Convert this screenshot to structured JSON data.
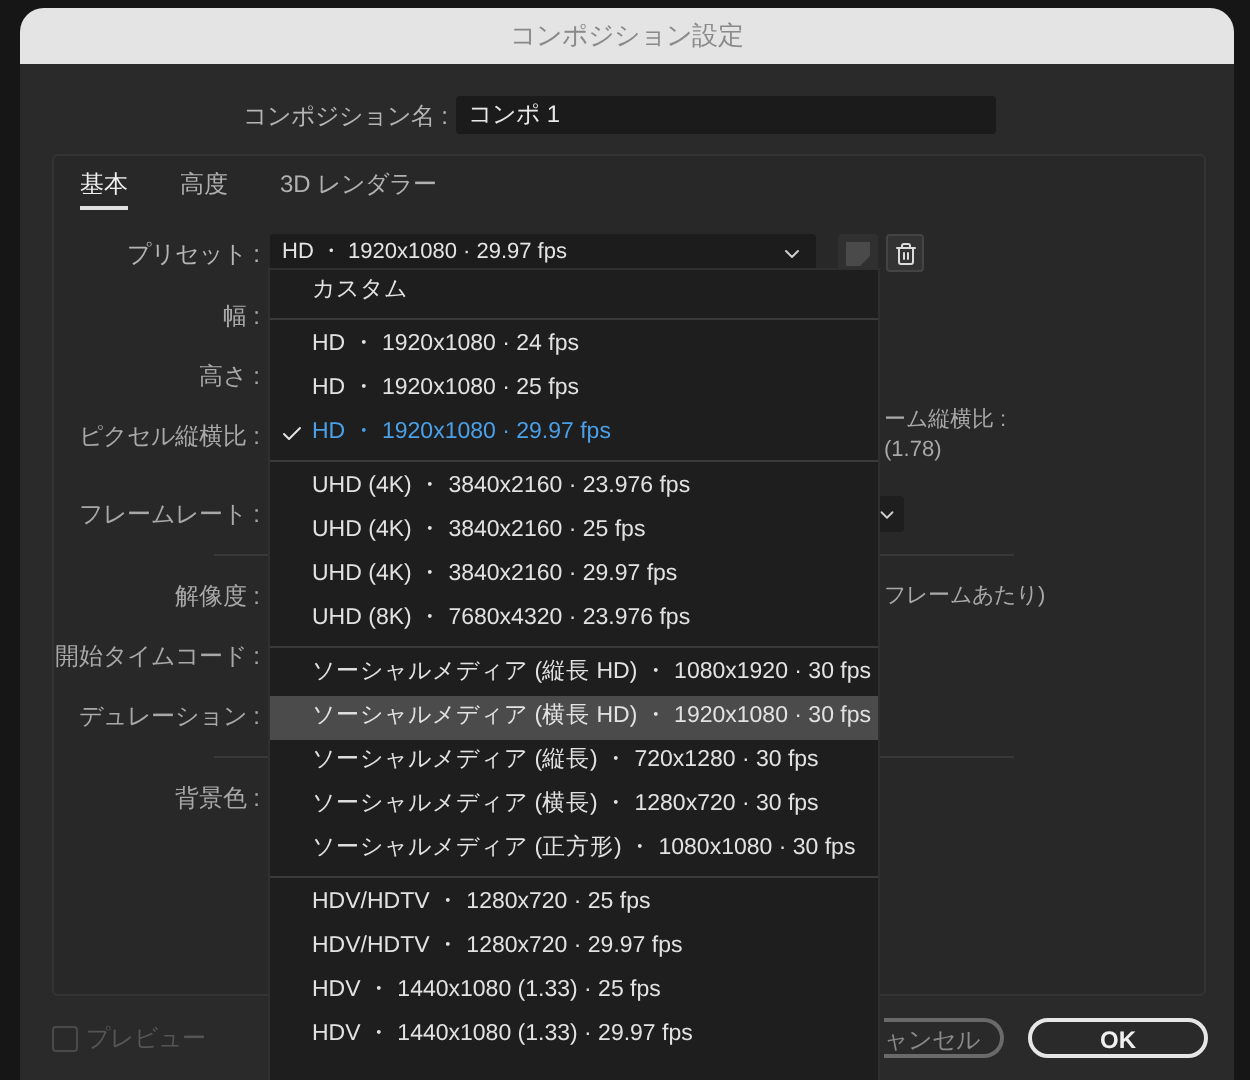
{
  "window": {
    "title": "コンポジション設定"
  },
  "composition_name": {
    "label": "コンポジション名 :",
    "value": "コンポ 1"
  },
  "tabs": [
    {
      "label": "基本",
      "selected": true
    },
    {
      "label": "高度",
      "selected": false
    },
    {
      "label": "3D レンダラー",
      "selected": false
    }
  ],
  "preset": {
    "label": "プリセット :",
    "value": "HD ・ 1920x1080 · 29.97 fps"
  },
  "fields": [
    {
      "label": "幅 :"
    },
    {
      "label": "高さ :"
    },
    {
      "label": "ピクセル縦横比 :",
      "aside": [
        "ーム縦横比 :",
        "(1.78)"
      ]
    },
    {
      "label": "フレームレート :",
      "dropdown": true
    },
    {
      "label": "解像度 :",
      "aside": [
        "フレームあたり)"
      ],
      "divider_before": true
    },
    {
      "label": "開始タイムコード :"
    },
    {
      "label": "デュレーション :"
    },
    {
      "label": "背景色 :",
      "divider_before": true
    }
  ],
  "preset_menu": [
    {
      "kind": "item",
      "label": "カスタム",
      "selected": false,
      "highlighted": false
    },
    {
      "kind": "separator"
    },
    {
      "kind": "item",
      "label": "HD ・ 1920x1080 · 24 fps",
      "selected": false,
      "highlighted": false
    },
    {
      "kind": "item",
      "label": "HD ・ 1920x1080 · 25 fps",
      "selected": false,
      "highlighted": false
    },
    {
      "kind": "item",
      "label": "HD ・ 1920x1080 · 29.97 fps",
      "selected": true,
      "highlighted": false
    },
    {
      "kind": "separator"
    },
    {
      "kind": "item",
      "label": "UHD (4K) ・ 3840x2160 · 23.976 fps",
      "selected": false,
      "highlighted": false
    },
    {
      "kind": "item",
      "label": "UHD (4K) ・ 3840x2160 · 25 fps",
      "selected": false,
      "highlighted": false
    },
    {
      "kind": "item",
      "label": "UHD (4K) ・ 3840x2160 · 29.97 fps",
      "selected": false,
      "highlighted": false
    },
    {
      "kind": "item",
      "label": "UHD (8K) ・ 7680x4320 · 23.976 fps",
      "selected": false,
      "highlighted": false
    },
    {
      "kind": "separator"
    },
    {
      "kind": "item",
      "label": "ソーシャルメディア (縦長 HD) ・ 1080x1920 · 30 fps",
      "selected": false,
      "highlighted": false
    },
    {
      "kind": "item",
      "label": "ソーシャルメディア (横長 HD) ・ 1920x1080 · 30 fps",
      "selected": false,
      "highlighted": true
    },
    {
      "kind": "item",
      "label": "ソーシャルメディア (縦長) ・ 720x1280 · 30 fps",
      "selected": false,
      "highlighted": false
    },
    {
      "kind": "item",
      "label": "ソーシャルメディア (横長) ・ 1280x720 · 30 fps",
      "selected": false,
      "highlighted": false
    },
    {
      "kind": "item",
      "label": "ソーシャルメディア (正方形) ・ 1080x1080 · 30 fps",
      "selected": false,
      "highlighted": false
    },
    {
      "kind": "separator"
    },
    {
      "kind": "item",
      "label": "HDV/HDTV ・ 1280x720 · 25 fps",
      "selected": false,
      "highlighted": false
    },
    {
      "kind": "item",
      "label": "HDV/HDTV ・ 1280x720 · 29.97 fps",
      "selected": false,
      "highlighted": false
    },
    {
      "kind": "item",
      "label": "HDV ・ 1440x1080 (1.33) · 25 fps",
      "selected": false,
      "highlighted": false
    },
    {
      "kind": "item",
      "label": "HDV ・ 1440x1080 (1.33) · 29.97 fps",
      "selected": false,
      "highlighted": false
    }
  ],
  "preview": {
    "label": "プレビュー",
    "checked": false,
    "disabled": true
  },
  "buttons": [
    {
      "kind": "secondary",
      "label": "ャンセル"
    },
    {
      "kind": "primary",
      "label": "OK"
    }
  ]
}
